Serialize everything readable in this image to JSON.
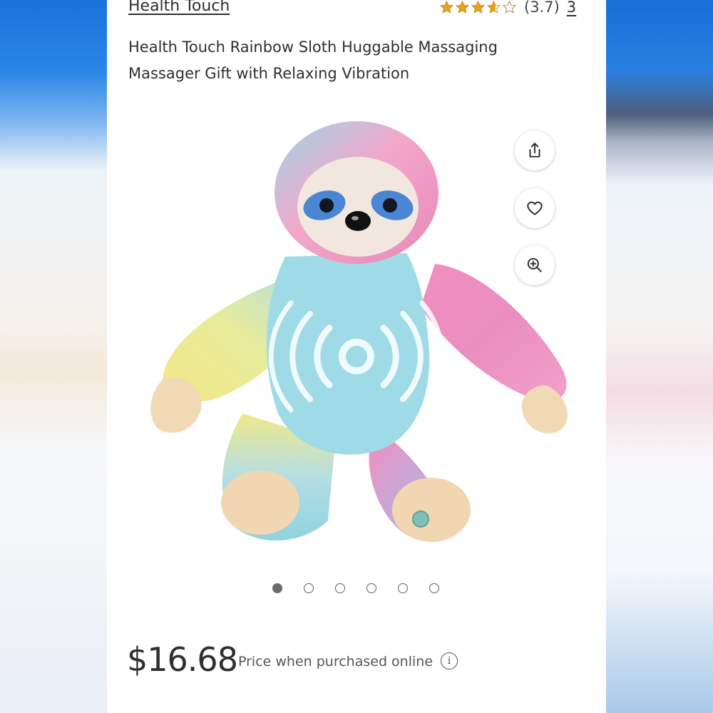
{
  "brand": "Health Touch",
  "rating": {
    "value": "(3.7)",
    "stars": 3.7,
    "max": 5,
    "review_count": "3",
    "star_color": "#e6a21a"
  },
  "product": {
    "title_line1": "Health Touch Rainbow Sloth Huggable Massaging",
    "title_line2": "Massager Gift with Relaxing Vibration"
  },
  "actions": [
    {
      "name": "share",
      "icon": "share-icon"
    },
    {
      "name": "favorite",
      "icon": "heart-icon"
    },
    {
      "name": "zoom",
      "icon": "zoom-in-icon"
    }
  ],
  "gallery": {
    "count": 6,
    "active": 0
  },
  "pricing": {
    "price": "$16.68",
    "note": "Price when purchased online",
    "info_icon": "i"
  }
}
